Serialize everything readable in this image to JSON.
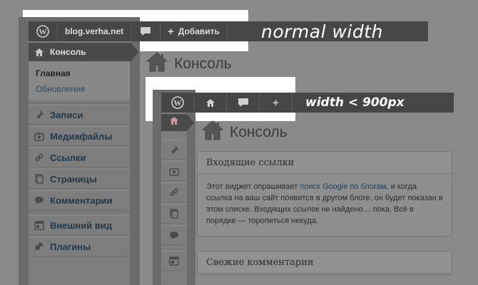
{
  "normal": {
    "badge": "normal width",
    "topbar": {
      "site_name": "blog.verha.net",
      "add_label": "Добавить"
    },
    "menu": {
      "active_label": "Консоль",
      "sub_items": [
        "Главная",
        "Обновления"
      ],
      "items": [
        {
          "icon": "pushpin-icon",
          "label": "Записи"
        },
        {
          "icon": "media-icon",
          "label": "Медиафайлы"
        },
        {
          "icon": "links-icon",
          "label": "Ссылки"
        },
        {
          "icon": "pages-icon",
          "label": "Страницы"
        },
        {
          "icon": "comments-icon",
          "label": "Комментарии"
        },
        {
          "icon": "appearance-icon",
          "label": "Внешний вид"
        },
        {
          "icon": "plugins-icon",
          "label": "Плагины"
        }
      ]
    },
    "page_title": "Консоль"
  },
  "narrow": {
    "badge": "width < 900px",
    "page_title": "Консоль",
    "widgets": [
      {
        "title": "Входящие ссылки",
        "text_before": "Этот виджет опрашивает ",
        "link": "поиск Google по блогам",
        "text_after": ", и когда ссылка на ваш сайт появится в другом блоге, он будет показан в этом списке. Входящих ссылок не найдено… пока. Всё в порядке — торопиться некуда."
      },
      {
        "title": "Свежие комментарии"
      }
    ]
  },
  "colors": {
    "toolbar": "#464646",
    "background": "#8a8a8a",
    "highlight": "#ffffff"
  }
}
